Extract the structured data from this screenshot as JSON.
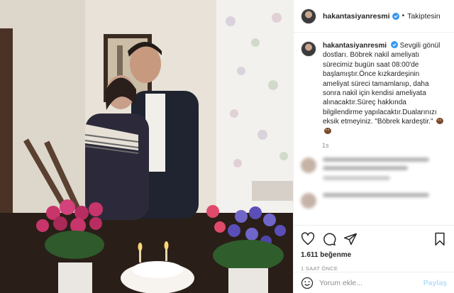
{
  "post": {
    "username": "hakantasiyanresmi",
    "separator": "•",
    "follow_state": "Takiptesin",
    "caption_username": "hakantasiyanresmi",
    "caption_text": "Sevgili gönül dostları. Böbrek nakil ameliyatı sürecimiz bugün saat 08:00'de başlamıştır.Önce kızkardeşinin ameliyat süreci tamamlanıp, daha sonra nakil için kendisi ameliyata alınacaktır.Süreç hakkında bilgilendirme yapılacaktır.Dualarınızı eksik etmeyiniz. \"Böbrek kardeştir.\"",
    "caption_time": "1s",
    "likes": "1.611 beğenme",
    "posted_ago": "1 SAAT ÖNCE",
    "comment_placeholder": "Yorum ekle...",
    "share_label": "Paylaş"
  },
  "icons": {
    "verified": "verified-badge-icon",
    "like": "heart-icon",
    "comment": "comment-icon",
    "share": "paper-plane-icon",
    "save": "bookmark-icon",
    "emoji": "smile-icon"
  },
  "colors": {
    "verified": "#3897f0",
    "share_disabled": "#b2dffc",
    "muted": "#8e8e8e",
    "text": "#262626"
  }
}
